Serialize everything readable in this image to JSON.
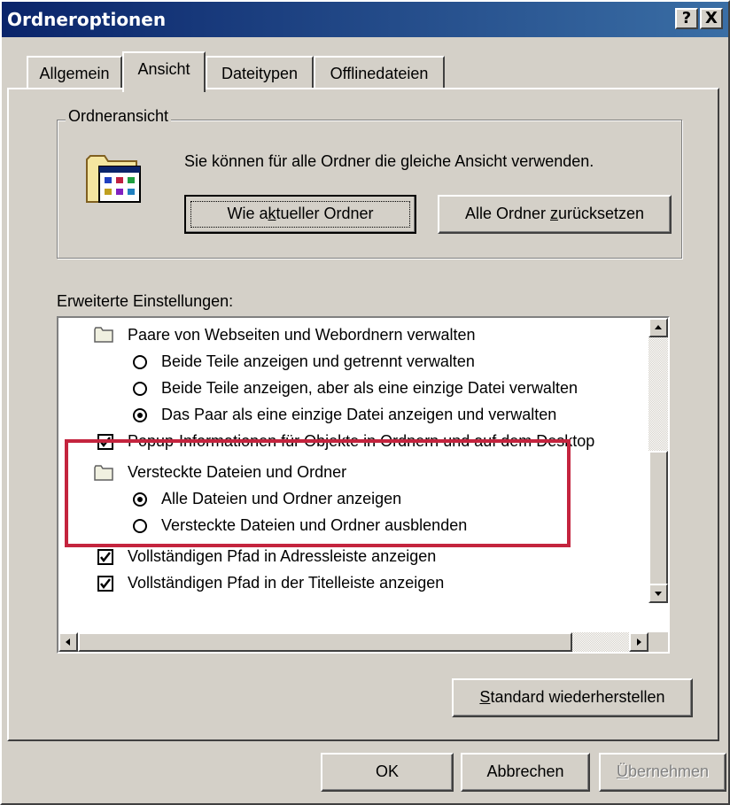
{
  "window": {
    "title": "Ordneroptionen",
    "help_button": "?",
    "close_button": "X"
  },
  "tabs": [
    {
      "label": "Allgemein",
      "active": false
    },
    {
      "label": "Ansicht",
      "active": true
    },
    {
      "label": "Dateitypen",
      "active": false
    },
    {
      "label": "Offlinedateien",
      "active": false
    }
  ],
  "folder_view": {
    "group_label": "Ordneransicht",
    "description": "Sie können für alle Ordner die gleiche Ansicht verwenden.",
    "apply_button": {
      "before": "Wie a",
      "mnemonic": "k",
      "after": "tueller Ordner"
    },
    "reset_button": {
      "before": "Alle Ordner ",
      "mnemonic": "z",
      "after": "urücksetzen"
    },
    "icon": "folder-view-icon"
  },
  "advanced": {
    "label": "Erweiterte Einstellungen:",
    "items": [
      {
        "type": "folder",
        "label": "Paare von Webseiten und Webordnern verwalten"
      },
      {
        "type": "radio",
        "checked": false,
        "label": "Beide Teile anzeigen und getrennt verwalten"
      },
      {
        "type": "radio",
        "checked": false,
        "label": "Beide Teile anzeigen, aber als eine einzige Datei verwalten"
      },
      {
        "type": "radio",
        "checked": true,
        "label": "Das Paar als eine einzige Datei anzeigen und verwalten"
      },
      {
        "type": "checkbox",
        "checked": true,
        "label": "Popup-Informationen für Objekte in Ordnern und auf dem Desktop"
      },
      {
        "type": "folder",
        "label": "Versteckte Dateien und Ordner"
      },
      {
        "type": "radio",
        "checked": true,
        "label": "Alle Dateien und Ordner anzeigen"
      },
      {
        "type": "radio",
        "checked": false,
        "label": "Versteckte Dateien und Ordner ausblenden"
      },
      {
        "type": "checkbox",
        "checked": true,
        "label": "Vollständigen Pfad in Adressleiste anzeigen"
      },
      {
        "type": "checkbox",
        "checked": true,
        "label": "Vollständigen Pfad in der Titelleiste anzeigen"
      }
    ]
  },
  "restore_button": {
    "mnemonic": "S",
    "after": "tandard wiederherstellen"
  },
  "footer": {
    "ok": "OK",
    "cancel": "Abbrechen",
    "apply": {
      "mnemonic": "Ü",
      "after": "bernehmen",
      "disabled": true
    }
  },
  "colors": {
    "highlight": "#c4243e",
    "face": "#d4d0c8",
    "titlebar": "#0a246a"
  }
}
